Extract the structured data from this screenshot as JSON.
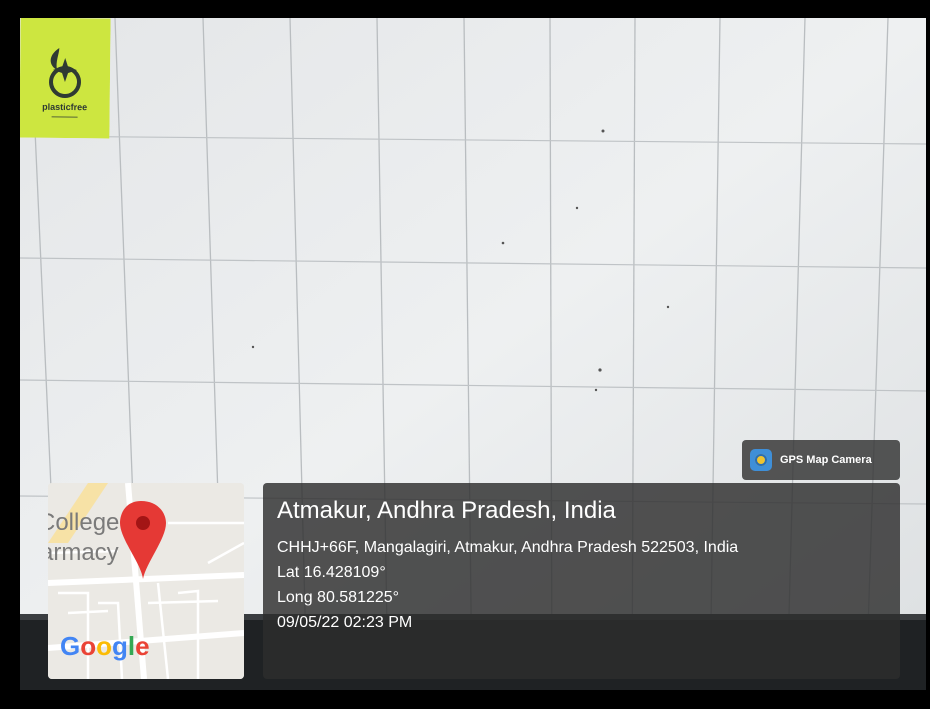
{
  "overlay": {
    "app_badge": "GPS Map Camera",
    "app_icon": "gps-map-camera-icon",
    "location_title": "Atmakur, Andhra Pradesh, India",
    "address": "CHHJ+66F, Mangalagiri, Atmakur, Andhra Pradesh 522503, India",
    "latitude": "Lat 16.428109°",
    "longitude": "Long 80.581225°",
    "datetime": "09/05/22 02:23 PM"
  },
  "map": {
    "label_line1": "College",
    "label_line2": "armacy",
    "provider": "Google",
    "pin_icon": "map-pin-icon",
    "colors": {
      "pin": "#e53935",
      "google_blue": "#4285F4",
      "google_red": "#EA4335",
      "google_yellow": "#FBBC05",
      "google_green": "#34A853"
    }
  },
  "scene": {
    "sticker_text": "plasticfree",
    "sticker_color": "#c9e33d"
  }
}
